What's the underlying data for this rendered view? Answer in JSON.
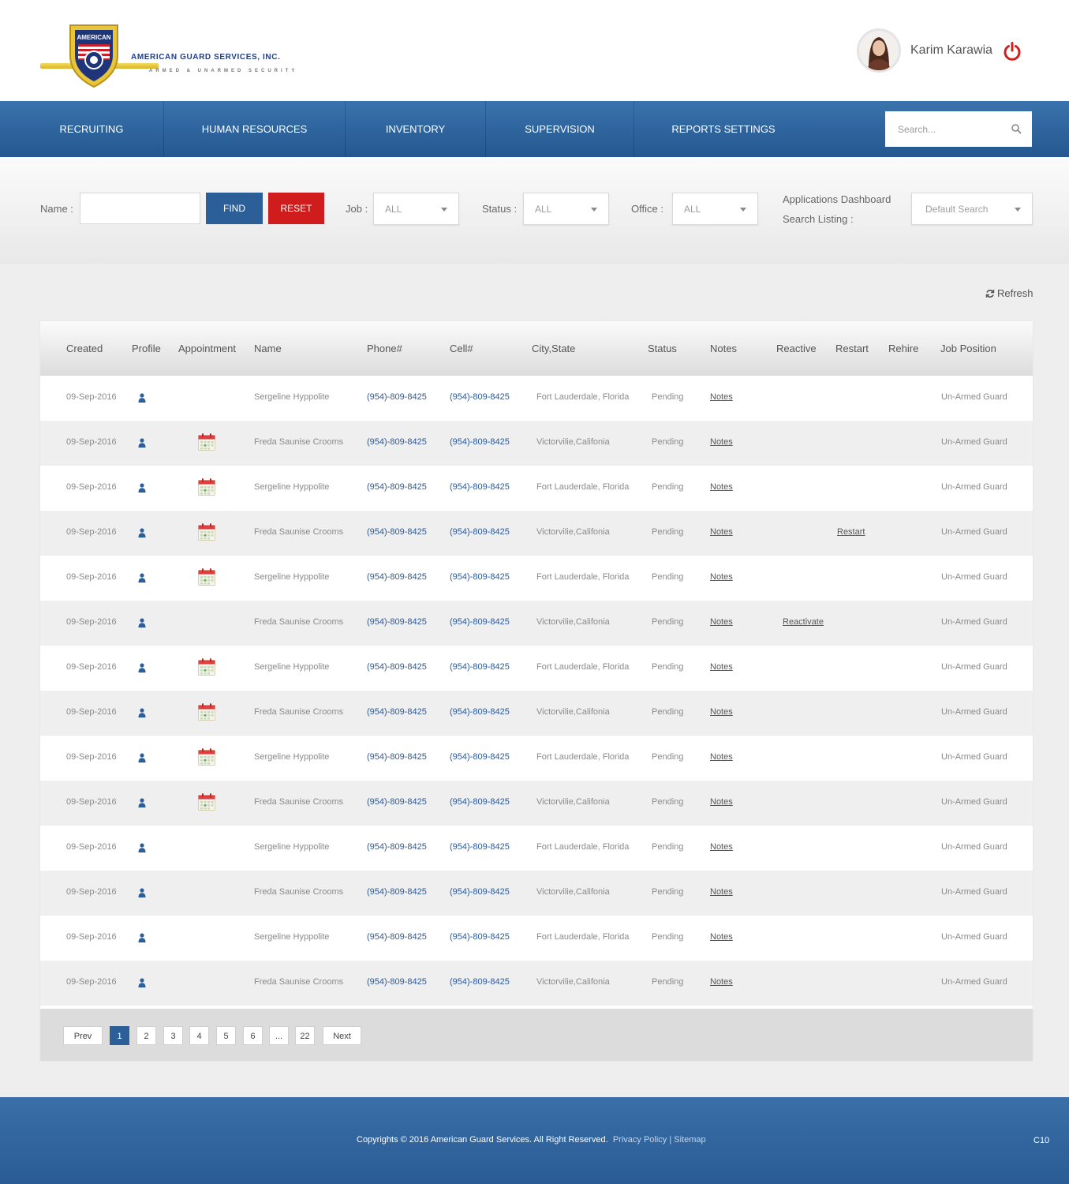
{
  "brand": {
    "name": "AMERICAN GUARD SERVICES, INC.",
    "tagline": "ARMED & UNARMED SECURITY",
    "shield_text": "AMERICAN"
  },
  "user": {
    "name": "Karim Karawia"
  },
  "nav": {
    "items": [
      {
        "label": "RECRUITING"
      },
      {
        "label": "HUMAN RESOURCES"
      },
      {
        "label": "INVENTORY"
      },
      {
        "label": "SUPERVISION"
      },
      {
        "label": "REPORTS SETTINGS"
      }
    ],
    "search_placeholder": "Search..."
  },
  "filters": {
    "name_label": "Name :",
    "name_value": "",
    "find_label": "FIND",
    "reset_label": "RESET",
    "job_label": "Job :",
    "job_value": "ALL",
    "status_label": "Status :",
    "status_value": "ALL",
    "office_label": "Office :",
    "office_value": "ALL",
    "dashboard_label_1": "Applications Dashboard",
    "dashboard_label_2": "Search Listing :",
    "dashboard_value": "Default Search"
  },
  "refresh_label": "Refresh",
  "table": {
    "headers": {
      "created": "Created",
      "profile": "Profile",
      "appointment": "Appointment",
      "name": "Name",
      "phone": "Phone#",
      "cell": "Cell#",
      "city": "City,State",
      "status": "Status",
      "notes": "Notes",
      "reactive": "Reactive",
      "restart": "Restart",
      "rehire": "Rehire",
      "job": "Job Position"
    },
    "rows": [
      {
        "created": "09-Sep-2016",
        "appointment": false,
        "name": "Sergeline Hyppolite",
        "phone": "(954)-809-8425",
        "cell": "(954)-809-8425",
        "city": "Fort Lauderdale, Florida",
        "status": "Pending",
        "notes": "Notes",
        "reactive": "",
        "restart": "",
        "rehire": "",
        "job": "Un-Armed Guard"
      },
      {
        "created": "09-Sep-2016",
        "appointment": true,
        "name": "Freda Saunise Crooms",
        "phone": "(954)-809-8425",
        "cell": "(954)-809-8425",
        "city": "Victorvilie,Califonia",
        "status": "Pending",
        "notes": "Notes",
        "reactive": "",
        "restart": "",
        "rehire": "",
        "job": "Un-Armed Guard"
      },
      {
        "created": "09-Sep-2016",
        "appointment": true,
        "name": "Sergeline Hyppolite",
        "phone": "(954)-809-8425",
        "cell": "(954)-809-8425",
        "city": "Fort Lauderdale, Florida",
        "status": "Pending",
        "notes": "Notes",
        "reactive": "",
        "restart": "",
        "rehire": "",
        "job": "Un-Armed Guard"
      },
      {
        "created": "09-Sep-2016",
        "appointment": true,
        "name": "Freda Saunise Crooms",
        "phone": "(954)-809-8425",
        "cell": "(954)-809-8425",
        "city": "Victorvilie,Califonia",
        "status": "Pending",
        "notes": "Notes",
        "reactive": "",
        "restart": "Restart",
        "rehire": "",
        "job": "Un-Armed Guard"
      },
      {
        "created": "09-Sep-2016",
        "appointment": true,
        "name": "Sergeline Hyppolite",
        "phone": "(954)-809-8425",
        "cell": "(954)-809-8425",
        "city": "Fort Lauderdale, Florida",
        "status": "Pending",
        "notes": "Notes",
        "reactive": "",
        "restart": "",
        "rehire": "",
        "job": "Un-Armed Guard"
      },
      {
        "created": "09-Sep-2016",
        "appointment": false,
        "name": "Freda Saunise Crooms",
        "phone": "(954)-809-8425",
        "cell": "(954)-809-8425",
        "city": "Victorvilie,Califonia",
        "status": "Pending",
        "notes": "Notes",
        "reactive": "Reactivate",
        "restart": "",
        "rehire": "",
        "job": "Un-Armed Guard"
      },
      {
        "created": "09-Sep-2016",
        "appointment": true,
        "name": "Sergeline Hyppolite",
        "phone": "(954)-809-8425",
        "cell": "(954)-809-8425",
        "city": "Fort Lauderdale, Florida",
        "status": "Pending",
        "notes": "Notes",
        "reactive": "",
        "restart": "",
        "rehire": "",
        "job": "Un-Armed Guard"
      },
      {
        "created": "09-Sep-2016",
        "appointment": true,
        "name": "Freda Saunise Crooms",
        "phone": "(954)-809-8425",
        "cell": "(954)-809-8425",
        "city": "Victorvilie,Califonia",
        "status": "Pending",
        "notes": "Notes",
        "reactive": "",
        "restart": "",
        "rehire": "",
        "job": "Un-Armed Guard"
      },
      {
        "created": "09-Sep-2016",
        "appointment": true,
        "name": "Sergeline Hyppolite",
        "phone": "(954)-809-8425",
        "cell": "(954)-809-8425",
        "city": "Fort Lauderdale, Florida",
        "status": "Pending",
        "notes": "Notes",
        "reactive": "",
        "restart": "",
        "rehire": "",
        "job": "Un-Armed Guard"
      },
      {
        "created": "09-Sep-2016",
        "appointment": true,
        "name": "Freda Saunise Crooms",
        "phone": "(954)-809-8425",
        "cell": "(954)-809-8425",
        "city": "Victorvilie,Califonia",
        "status": "Pending",
        "notes": "Notes",
        "reactive": "",
        "restart": "",
        "rehire": "",
        "job": "Un-Armed Guard"
      },
      {
        "created": "09-Sep-2016",
        "appointment": false,
        "name": "Sergeline Hyppolite",
        "phone": "(954)-809-8425",
        "cell": "(954)-809-8425",
        "city": "Fort Lauderdale, Florida",
        "status": "Pending",
        "notes": "Notes",
        "reactive": "",
        "restart": "",
        "rehire": "",
        "job": "Un-Armed Guard"
      },
      {
        "created": "09-Sep-2016",
        "appointment": false,
        "name": "Freda Saunise Crooms",
        "phone": "(954)-809-8425",
        "cell": "(954)-809-8425",
        "city": "Victorvilie,Califonia",
        "status": "Pending",
        "notes": "Notes",
        "reactive": "",
        "restart": "",
        "rehire": "",
        "job": "Un-Armed Guard"
      },
      {
        "created": "09-Sep-2016",
        "appointment": false,
        "name": "Sergeline Hyppolite",
        "phone": "(954)-809-8425",
        "cell": "(954)-809-8425",
        "city": "Fort Lauderdale, Florida",
        "status": "Pending",
        "notes": "Notes",
        "reactive": "",
        "restart": "",
        "rehire": "",
        "job": "Un-Armed Guard"
      },
      {
        "created": "09-Sep-2016",
        "appointment": false,
        "name": "Freda Saunise Crooms",
        "phone": "(954)-809-8425",
        "cell": "(954)-809-8425",
        "city": "Victorvilie,Califonia",
        "status": "Pending",
        "notes": "Notes",
        "reactive": "",
        "restart": "",
        "rehire": "",
        "job": "Un-Armed Guard"
      }
    ]
  },
  "pagination": {
    "prev": "Prev",
    "pages": [
      "1",
      "2",
      "3",
      "4",
      "5",
      "6",
      "...",
      "22"
    ],
    "active": "1",
    "next": "Next"
  },
  "footer": {
    "copyright": "Copyrights © 2016 American Guard Services. All Right Reserved.",
    "privacy": "Privacy Policy",
    "separator": "|",
    "sitemap": "Sitemap",
    "code": "C10"
  },
  "colors": {
    "primary": "#2c5f98",
    "danger": "#d01c1c",
    "link_blue": "#2b5a9a",
    "calendar_red": "#e04040"
  },
  "icons": [
    "shield-logo",
    "avatar",
    "power-icon",
    "search-icon",
    "refresh-icon",
    "profile-icon",
    "calendar-icon",
    "caret-down-icon"
  ]
}
